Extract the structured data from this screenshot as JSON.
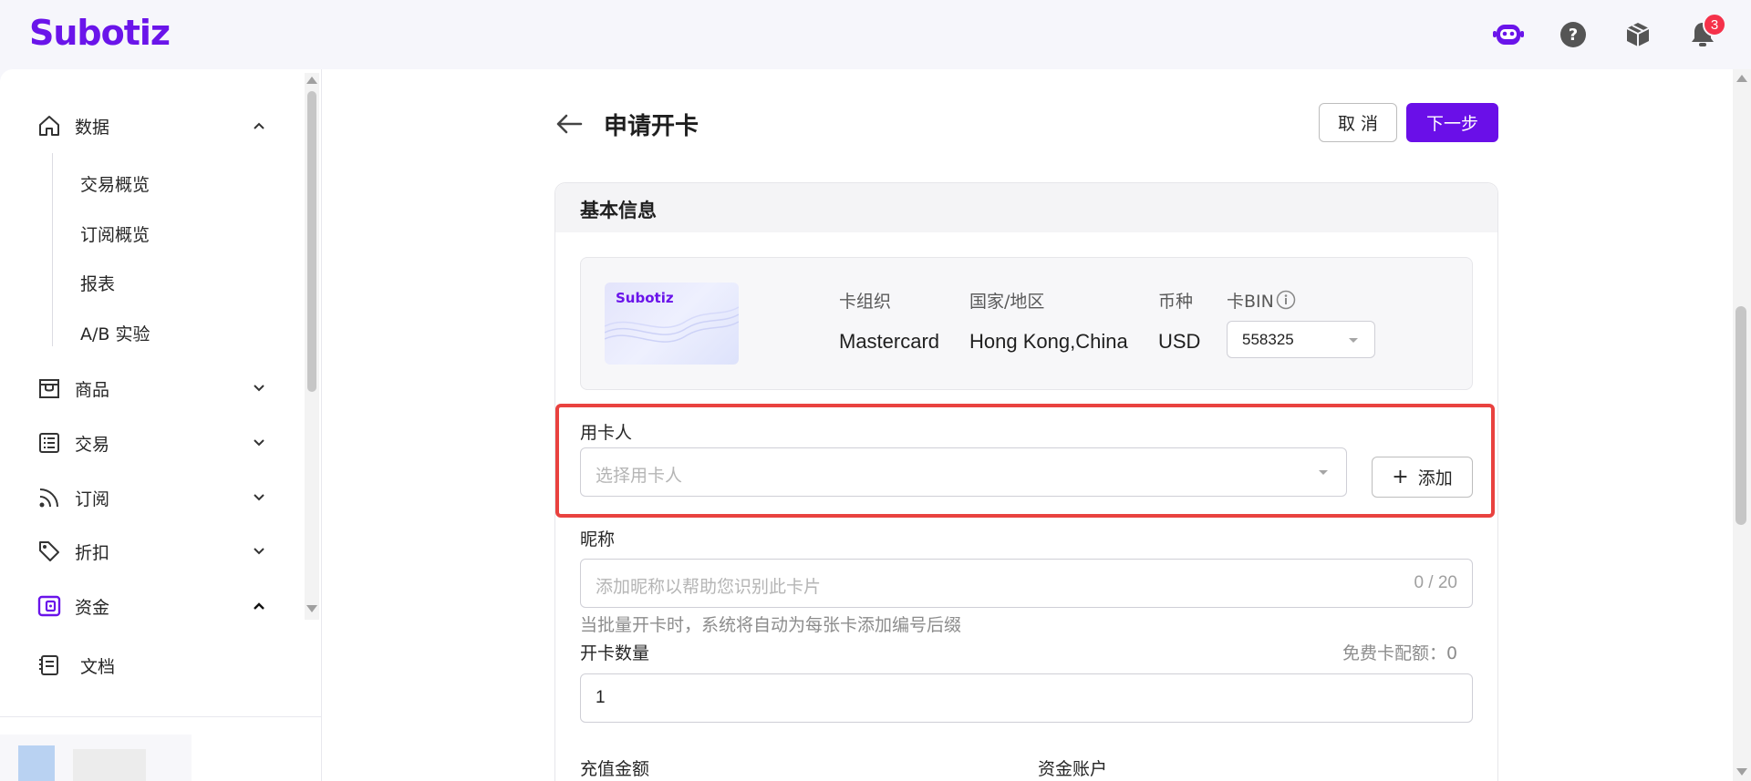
{
  "header": {
    "logo": "Subotiz",
    "notification_count": "3"
  },
  "sidebar": {
    "items": [
      {
        "label": "数据",
        "icon": "home-icon",
        "expanded": true
      },
      {
        "label": "商品",
        "icon": "store-icon",
        "expanded": false
      },
      {
        "label": "交易",
        "icon": "list-icon",
        "expanded": false
      },
      {
        "label": "订阅",
        "icon": "rss-icon",
        "expanded": false
      },
      {
        "label": "折扣",
        "icon": "tag-icon",
        "expanded": false
      },
      {
        "label": "资金",
        "icon": "wallet-icon",
        "expanded": true,
        "active": true
      },
      {
        "label": "文档",
        "icon": "document-icon"
      }
    ],
    "sub_items": [
      "交易概览",
      "订阅概览",
      "报表",
      "A/B 实验"
    ]
  },
  "page": {
    "title": "申请开卡",
    "cancel_label": "取 消",
    "next_label": "下一步"
  },
  "basic_info": {
    "section_title": "基本信息",
    "card_logo": "Subotiz",
    "org_label": "卡组织",
    "org_value": "Mastercard",
    "region_label": "国家/地区",
    "region_value": "Hong Kong,China",
    "currency_label": "币种",
    "currency_value": "USD",
    "bin_label": "卡BIN",
    "bin_value": "558325"
  },
  "form": {
    "cardholder_label": "用卡人",
    "cardholder_placeholder": "选择用卡人",
    "add_label": "添加",
    "nickname_label": "昵称",
    "nickname_placeholder": "添加昵称以帮助您识别此卡片",
    "nickname_counter": "0 / 20",
    "nickname_helper": "当批量开卡时，系统将自动为每张卡添加编号后缀",
    "quantity_label": "开卡数量",
    "free_quota": "免费卡配额：0",
    "quantity_value": "1",
    "recharge_label": "充值金额",
    "fund_account_label": "资金账户"
  },
  "colors": {
    "brand": "#6a14ea",
    "primary_button": "#6a0fe8",
    "highlight": "#e9423f",
    "badge": "#f5314a"
  }
}
